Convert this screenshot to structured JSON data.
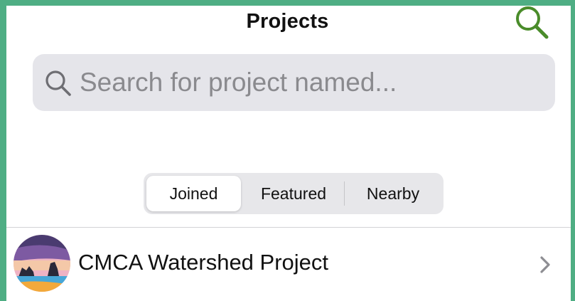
{
  "header": {
    "title": "Projects",
    "search_icon": "search-icon"
  },
  "search": {
    "placeholder": "Search for project named...",
    "value": ""
  },
  "tabs": [
    {
      "label": "Joined",
      "selected": true
    },
    {
      "label": "Featured",
      "selected": false
    },
    {
      "label": "Nearby",
      "selected": false
    }
  ],
  "projects": [
    {
      "name": "CMCA Watershed Project",
      "icon": "project-avatar"
    }
  ],
  "colors": {
    "accent": "#4fae84",
    "header_icon": "#4a8c2a",
    "search_bg": "#e5e5ea",
    "placeholder": "#8a8a8e"
  }
}
